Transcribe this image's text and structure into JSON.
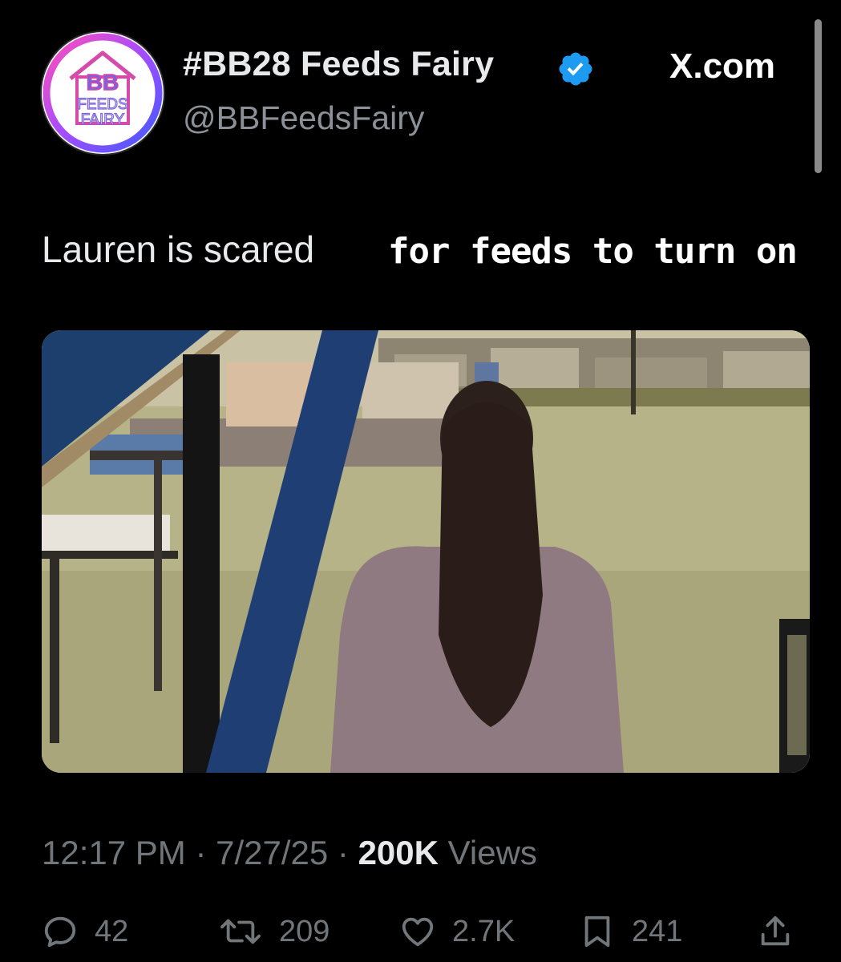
{
  "tweet": {
    "author": {
      "display_name": "#BB28 Feeds Fairy",
      "handle": "@BBFeedsFairy",
      "verified": true,
      "avatar_text": [
        "BB",
        "FEEDS",
        "FAIRY"
      ]
    },
    "site_label": "X.com",
    "text": "Lauren is scared",
    "caption_overlay": "for feeds to turn on",
    "meta": {
      "time": "12:17 PM",
      "separator": " · ",
      "date": "7/27/25",
      "views_count": "200K",
      "views_label": " Views"
    },
    "actions": {
      "replies": "42",
      "reposts": "209",
      "likes": "2.7K",
      "bookmarks": "241"
    }
  },
  "colors": {
    "background": "#000000",
    "primary_text": "#e7e9ea",
    "secondary_text": "#71767b",
    "verified_blue": "#1d9bf0"
  },
  "icons": {
    "verified": "verified-badge-icon",
    "reply": "reply-icon",
    "repost": "repost-icon",
    "like": "heart-icon",
    "bookmark": "bookmark-icon",
    "share": "share-icon"
  }
}
